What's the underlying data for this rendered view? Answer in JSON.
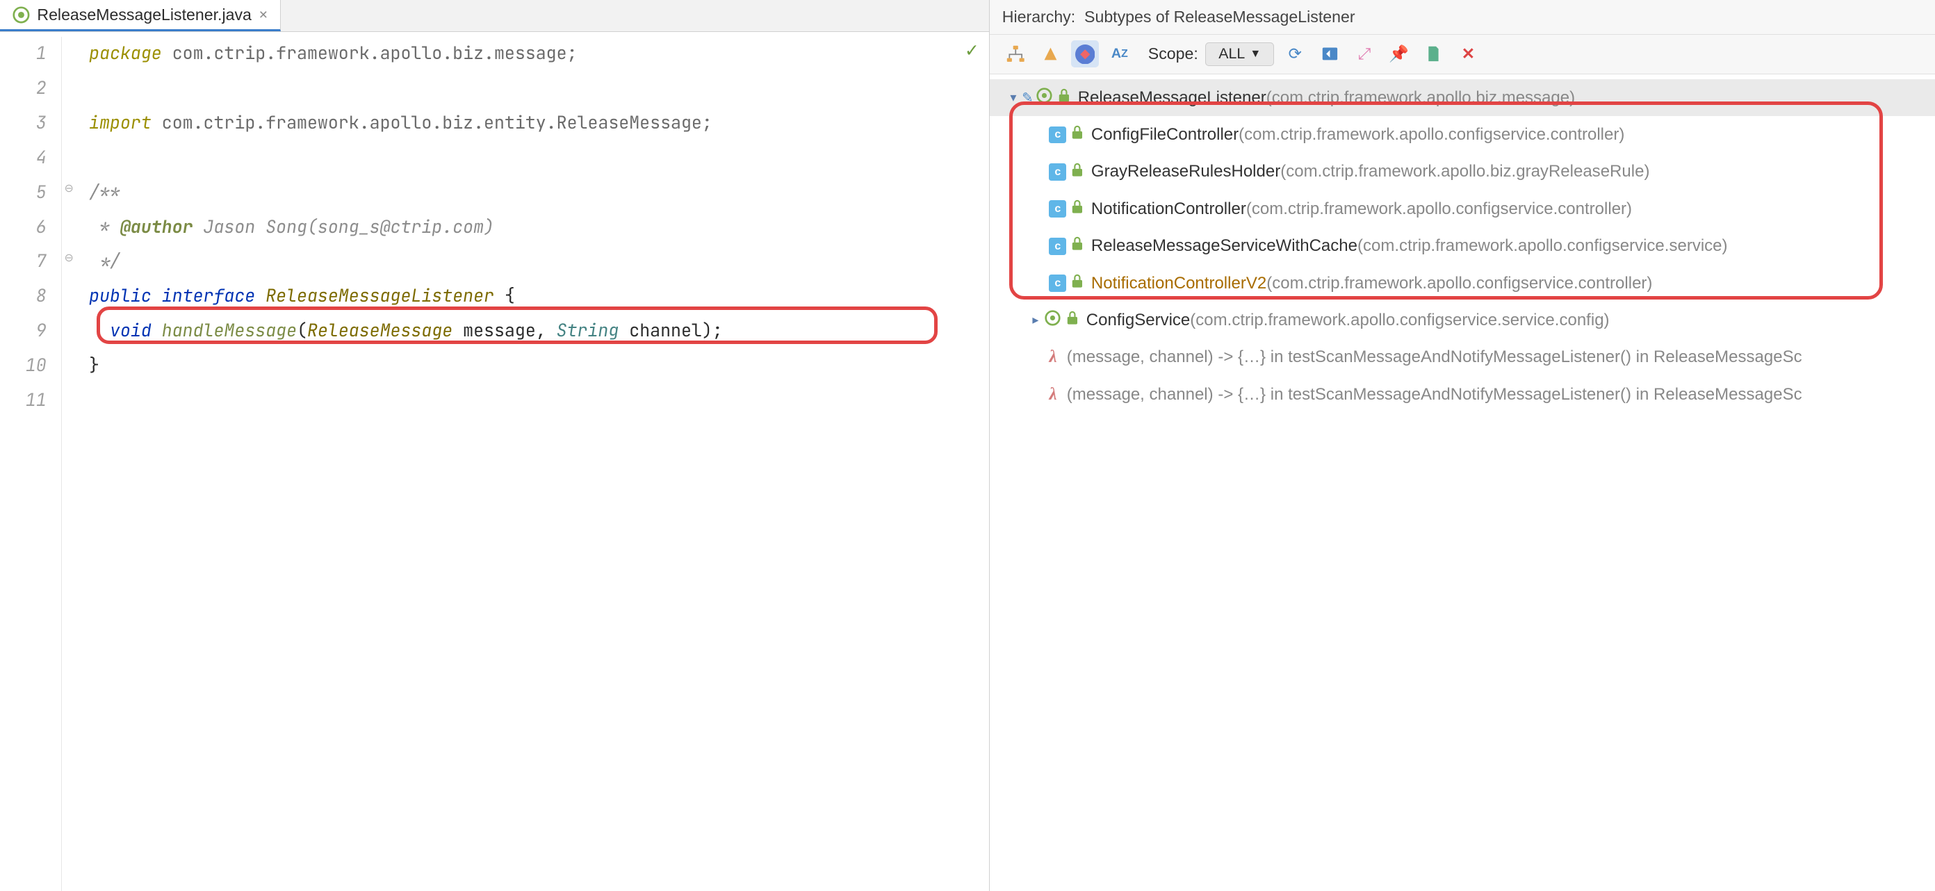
{
  "tab": {
    "filename": "ReleaseMessageListener.java"
  },
  "code": {
    "lines": [
      {
        "n": "1",
        "html": "<span class='kw-pkg'>package</span> <span class='str-pkg'>com.ctrip.framework.apollo.biz.message;</span>"
      },
      {
        "n": "2",
        "html": ""
      },
      {
        "n": "3",
        "html": "<span class='kw-pkg'>import</span> <span class='str-pkg'>com.ctrip.framework.apollo.biz.entity.ReleaseMessage;</span>"
      },
      {
        "n": "4",
        "html": ""
      },
      {
        "n": "5",
        "html": "<span class='comment'>/**</span>"
      },
      {
        "n": "6",
        "html": "<span class='comment'> * </span><span class='doc-tag'>@author</span><span class='comment'> Jason Song(song_s@ctrip.com)</span>"
      },
      {
        "n": "7",
        "html": "<span class='comment'> */</span>"
      },
      {
        "n": "8",
        "html": "<span class='type'>public interface</span> <span class='classname'>ReleaseMessageListener</span> {"
      },
      {
        "n": "9",
        "html": "  <span class='type'>void</span> <span class='method'>handleMessage</span>(<span class='classname'>ReleaseMessage</span> message, <span class='param'>String</span> channel);"
      },
      {
        "n": "10",
        "html": "}"
      },
      {
        "n": "11",
        "html": ""
      }
    ]
  },
  "hierarchy": {
    "title_prefix": "Hierarchy:",
    "title": "Subtypes of ReleaseMessageListener",
    "scope_label": "Scope:",
    "scope_value": "ALL",
    "root": {
      "name": "ReleaseMessageListener",
      "pkg": "(com.ctrip.framework.apollo.biz.message)"
    },
    "children": [
      {
        "name": "ConfigFileController",
        "pkg": "(com.ctrip.framework.apollo.configservice.controller)",
        "highlight": false
      },
      {
        "name": "GrayReleaseRulesHolder",
        "pkg": "(com.ctrip.framework.apollo.biz.grayReleaseRule)",
        "highlight": false
      },
      {
        "name": "NotificationController",
        "pkg": "(com.ctrip.framework.apollo.configservice.controller)",
        "highlight": false
      },
      {
        "name": "ReleaseMessageServiceWithCache",
        "pkg": "(com.ctrip.framework.apollo.configservice.service)",
        "highlight": false
      },
      {
        "name": "NotificationControllerV2",
        "pkg": "(com.ctrip.framework.apollo.configservice.controller)",
        "highlight": true
      }
    ],
    "extra": [
      {
        "kind": "class",
        "name": "ConfigService",
        "pkg": "(com.ctrip.framework.apollo.configservice.service.config)"
      },
      {
        "kind": "lambda",
        "name": "(message, channel) -> {…} in testScanMessageAndNotifyMessageListener() in ReleaseMessageSc"
      },
      {
        "kind": "lambda",
        "name": "(message, channel) -> {…} in testScanMessageAndNotifyMessageListener() in ReleaseMessageSc"
      }
    ]
  }
}
